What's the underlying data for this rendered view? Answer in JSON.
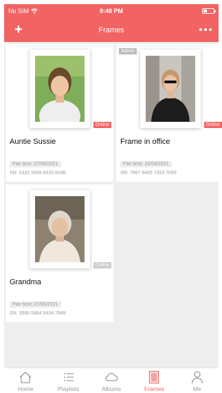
{
  "status_bar": {
    "carrier": "No SIM",
    "time": "9:48 PM"
  },
  "nav": {
    "title": "Frames"
  },
  "frames": [
    {
      "name": "Auntie Sussie",
      "status": "Online",
      "status_color": "#f26363",
      "role": "",
      "pair_time": "Pair time: 07/06/2021",
      "sn": "SN: 0332 5839 8320 8188"
    },
    {
      "name": "Frame in office",
      "status": "Online",
      "status_color": "#f26363",
      "role": "Admin",
      "pair_time": "Pair time: 26/04/2021",
      "sn": "SN: 7967 9405 7353 7093"
    },
    {
      "name": "Grandma",
      "status": "Online",
      "status_color": "#cccccc",
      "role": "",
      "pair_time": "Pair time: 07/06/2021",
      "sn": "SN: 3566 5464 8434 7848"
    }
  ],
  "tabs": [
    {
      "label": "Home",
      "icon": "home-icon",
      "active": false
    },
    {
      "label": "Playlists",
      "icon": "list-icon",
      "active": false
    },
    {
      "label": "Albums",
      "icon": "cloud-icon",
      "active": false
    },
    {
      "label": "Frames",
      "icon": "frame-icon",
      "active": true
    },
    {
      "label": "Me",
      "icon": "person-icon",
      "active": false
    }
  ],
  "colors": {
    "accent": "#f26363",
    "background": "#eeeeee",
    "online": "#f26363",
    "offline": "#cccccc"
  }
}
